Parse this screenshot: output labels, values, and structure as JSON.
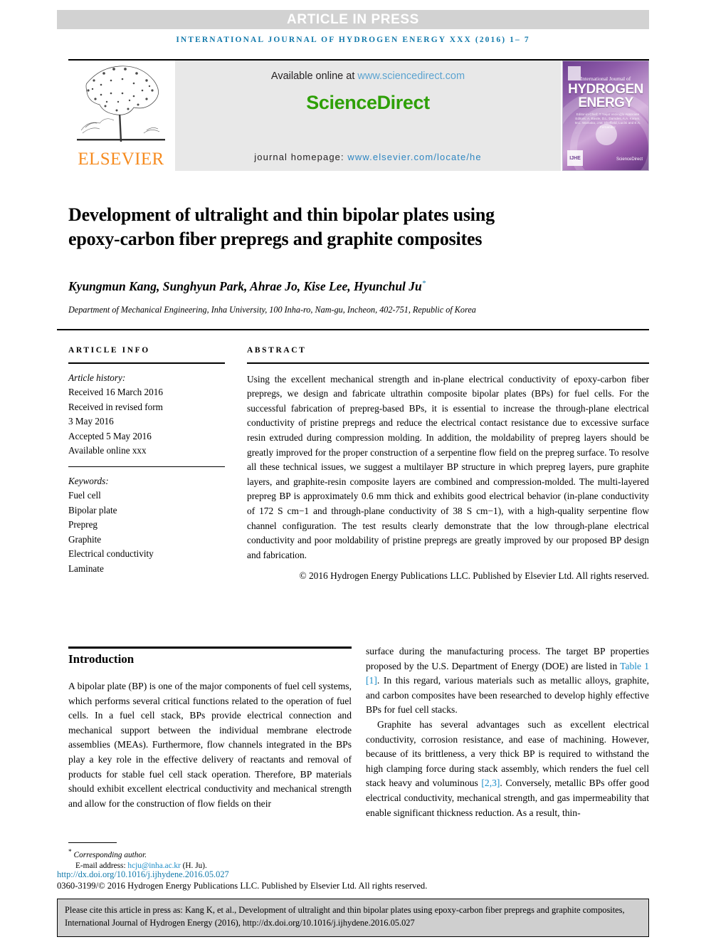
{
  "header": {
    "article_in_press": "ARTICLE IN PRESS",
    "running_head": "INTERNATIONAL JOURNAL OF HYDROGEN ENERGY XXX (2016) 1– 7"
  },
  "masthead": {
    "elsevier_wordmark": "ELSEVIER",
    "available_prefix": "Available online at ",
    "sciencedirect_url": "www.sciencedirect.com",
    "sciencedirect_wordmark": "ScienceDirect",
    "homepage_prefix": "journal homepage: ",
    "homepage_url": "www.elsevier.com/locate/he",
    "cover": {
      "line1": "International Journal of",
      "line2": "HYDROGEN",
      "line3": "ENERGY",
      "editors": "Editor-in-Chief: T. Nejat Veziroğlu   Associate Editors: A. Basile, D.L. Damdes, A.A. Karam, M.L. Wantaka, J.W. Sheffield, Lucíni and E.A. Fernandez",
      "badge": "IJHE",
      "sd_mini": "ScienceDirect"
    },
    "accent_green": "#2ea007",
    "accent_blue": "#2e86c1",
    "accent_orange": "#f68b1f"
  },
  "article": {
    "title": "Development of ultralight and thin bipolar plates using epoxy-carbon fiber prepregs and graphite composites",
    "authors": "Kyungmun Kang, Sunghyun Park, Ahrae Jo, Kise Lee, Hyunchul Ju",
    "corresponding_marker": "*",
    "affiliation": "Department of Mechanical Engineering, Inha University, 100 Inha-ro, Nam-gu, Incheon, 402-751, Republic of Korea"
  },
  "article_info": {
    "heading": "ARTICLE INFO",
    "history_label": "Article history:",
    "history": [
      "Received 16 March 2016",
      "Received in revised form",
      "3 May 2016",
      "Accepted 5 May 2016",
      "Available online xxx"
    ],
    "keywords_label": "Keywords:",
    "keywords": [
      "Fuel cell",
      "Bipolar plate",
      "Prepreg",
      "Graphite",
      "Electrical conductivity",
      "Laminate"
    ]
  },
  "abstract": {
    "heading": "ABSTRACT",
    "body": "Using the excellent mechanical strength and in-plane electrical conductivity of epoxy-carbon fiber prepregs, we design and fabricate ultrathin composite bipolar plates (BPs) for fuel cells. For the successful fabrication of prepreg-based BPs, it is essential to increase the through-plane electrical conductivity of pristine prepregs and reduce the electrical contact resistance due to excessive surface resin extruded during compression molding. In addition, the moldability of prepreg layers should be greatly improved for the proper construction of a serpentine flow field on the prepreg surface. To resolve all these technical issues, we suggest a multilayer BP structure in which prepreg layers, pure graphite layers, and graphite-resin composite layers are combined and compression-molded. The multi-layered prepreg BP is approximately 0.6 mm thick and exhibits good electrical behavior (in-plane conductivity of 172 S cm−1 and through-plane conductivity of 38 S cm−1), with a high-quality serpentine flow channel configuration. The test results clearly demonstrate that the low through-plane electrical conductivity and poor moldability of pristine prepregs are greatly improved by our proposed BP design and fabrication.",
    "copyright": "© 2016 Hydrogen Energy Publications LLC. Published by Elsevier Ltd. All rights reserved."
  },
  "introduction": {
    "heading": "Introduction",
    "paragraph_1": "A bipolar plate (BP) is one of the major components of fuel cell systems, which performs several critical functions related to the operation of fuel cells. In a fuel cell stack, BPs provide electrical connection and mechanical support between the individual membrane electrode assemblies (MEAs). Furthermore, flow channels integrated in the BPs play a key role in the effective delivery of reactants and removal of products for stable fuel cell stack operation. Therefore, BP materials should exhibit excellent electrical conductivity and mechanical strength and allow for the construction of flow fields on their",
    "paragraph_2_a": "surface during the manufacturing process. The target BP properties proposed by the U.S. Department of Energy (DOE) are listed in ",
    "paragraph_2_link": "Table 1 [1]",
    "paragraph_2_b": ". In this regard, various materials such as metallic alloys, graphite, and carbon composites have been researched to develop highly effective BPs for fuel cell stacks.",
    "paragraph_3_a": "Graphite has several advantages such as excellent electrical conductivity, corrosion resistance, and ease of machining. However, because of its brittleness, a very thick BP is required to withstand the high clamping force during stack assembly, which renders the fuel cell stack heavy and voluminous ",
    "paragraph_3_link": "[2,3]",
    "paragraph_3_b": ". Conversely, metallic BPs offer good electrical conductivity, mechanical strength, and gas impermeability that enable significant thickness reduction. As a result, thin-"
  },
  "footer": {
    "corresponding_author": "Corresponding author.",
    "email_label": "E-mail address: ",
    "email": "hcju@inha.ac.kr",
    "email_suffix": " (H. Ju).",
    "doi": "http://dx.doi.org/10.1016/j.ijhydene.2016.05.027",
    "issn_line": "0360-3199/© 2016 Hydrogen Energy Publications LLC. Published by Elsevier Ltd. All rights reserved."
  },
  "citation_box": {
    "text": "Please cite this article in press as: Kang K, et al., Development of ultralight and thin bipolar plates using epoxy-carbon fiber prepregs and graphite composites, International Journal of Hydrogen Energy (2016), http://dx.doi.org/10.1016/j.ijhydene.2016.05.027"
  }
}
